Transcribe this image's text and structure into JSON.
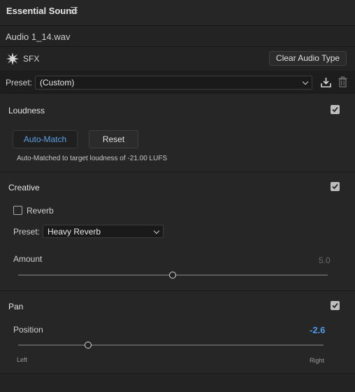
{
  "header": {
    "title": "Essential Sound",
    "menu_icon": "hamburger-icon"
  },
  "clip": {
    "filename": "Audio 1_14.wav",
    "type_icon": "sfx-burst-icon",
    "type_label": "SFX",
    "clear_button": "Clear Audio Type"
  },
  "preset": {
    "label": "Preset:",
    "value": "(Custom)",
    "save_icon": "save-preset-icon",
    "delete_icon": "trash-icon"
  },
  "loudness": {
    "title": "Loudness",
    "enabled": true,
    "auto_match_label": "Auto-Match",
    "reset_label": "Reset",
    "status": "Auto-Matched to target loudness of -21.00 LUFS"
  },
  "creative": {
    "title": "Creative",
    "enabled": true,
    "reverb_label": "Reverb",
    "reverb_checked": false,
    "preset_label": "Preset:",
    "preset_value": "Heavy Reverb",
    "amount_label": "Amount",
    "amount_value": "5.0",
    "amount_fraction": 0.5
  },
  "pan": {
    "title": "Pan",
    "enabled": true,
    "position_label": "Position",
    "position_value": "-2.6",
    "position_fraction": 0.23,
    "left_label": "Left",
    "right_label": "Right"
  },
  "colors": {
    "accent": "#4f9ae8"
  }
}
